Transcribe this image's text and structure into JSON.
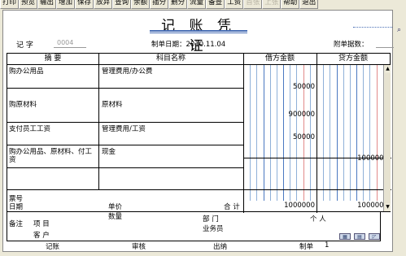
{
  "toolbar": {
    "buttons": [
      {
        "label": "打印",
        "disabled": false
      },
      {
        "label": "预览",
        "disabled": false
      },
      {
        "label": "输出",
        "disabled": false
      },
      {
        "label": "增加",
        "disabled": false
      },
      {
        "label": "保存",
        "disabled": false
      },
      {
        "label": "放弃",
        "disabled": false
      },
      {
        "label": "查询",
        "disabled": false
      },
      {
        "label": "余额",
        "disabled": false
      },
      {
        "label": "插分",
        "disabled": false
      },
      {
        "label": "删分",
        "disabled": false
      },
      {
        "label": "流量",
        "disabled": false
      },
      {
        "label": "备查",
        "disabled": false
      },
      {
        "label": "工资",
        "disabled": false
      },
      {
        "label": "首张",
        "disabled": true
      },
      {
        "label": "上张",
        "disabled": true
      },
      {
        "label": "帮助",
        "disabled": false
      },
      {
        "label": "退出",
        "disabled": false
      }
    ]
  },
  "voucher": {
    "title": "记 账 凭 证",
    "type_label": "记 字",
    "number": "0004",
    "date_label": "制单日期：2010.11.04",
    "attachments_label": "附单据数："
  },
  "grid": {
    "headers": {
      "summary": "摘 要",
      "subject": "科目名称",
      "debit": "借方金额",
      "credit": "贷方金额"
    },
    "rows": [
      {
        "summary": "购办公用品",
        "subject": "管理费用/办公费",
        "debit": "50000",
        "credit": ""
      },
      {
        "summary": "购原材料",
        "subject": "原材料",
        "debit": "900000",
        "credit": ""
      },
      {
        "summary": "支付员工工资",
        "subject": "管理费用/工资",
        "debit": "50000",
        "credit": ""
      },
      {
        "summary": "购办公用品、原材料、付工资",
        "subject": "现金",
        "debit": "",
        "credit": "1000000"
      },
      {
        "summary": "",
        "subject": "",
        "debit": "",
        "credit": ""
      }
    ],
    "totals": {
      "bill_no_label": "票号",
      "date_label": "日期",
      "unit_price_label": "单价",
      "quantity_label": "数量",
      "total_label": "合 计",
      "debit_total": "1000000",
      "credit_total": "1000000"
    }
  },
  "footer": {
    "remark_label": "备注",
    "project_label": "项 目",
    "dept_label": "部 门",
    "person_label": "个 人",
    "customer_label": "客 户",
    "salesman_label": "业务员"
  },
  "signatures": {
    "bookkeeper": "记账",
    "auditor": "审核",
    "cashier": "出纳",
    "maker_label": "制单",
    "maker_value": "1"
  },
  "colors": {
    "title_underline": "#4a6fb5",
    "digit_grid": "#8fb0d8",
    "digit_grid_red": "#e28a8a"
  },
  "icons": [
    "scroll-up-icon",
    "scroll-down-icon",
    "table-icon",
    "card-icon",
    "chart-icon",
    "search-icon"
  ]
}
